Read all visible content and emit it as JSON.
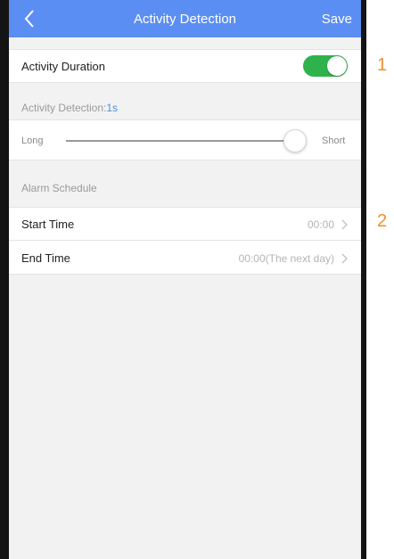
{
  "navbar": {
    "title": "Activity Detection",
    "save_label": "Save"
  },
  "activity_duration": {
    "label": "Activity Duration",
    "enabled": true
  },
  "activity_detection": {
    "label": "Activity Detection:",
    "value": "1s"
  },
  "slider": {
    "left_label": "Long",
    "right_label": "Short",
    "position": 1.0
  },
  "alarm_schedule": {
    "header": "Alarm Schedule"
  },
  "start_time": {
    "label": "Start Time",
    "value": "00:00"
  },
  "end_time": {
    "label": "End Time",
    "value": "00:00(The next day)"
  },
  "annotations": {
    "one": "1",
    "two": "2"
  },
  "colors": {
    "accent": "#5b8ef2",
    "toggle_on": "#2fb24b",
    "annotation": "#f0902e",
    "link_value": "#4a90e2"
  }
}
